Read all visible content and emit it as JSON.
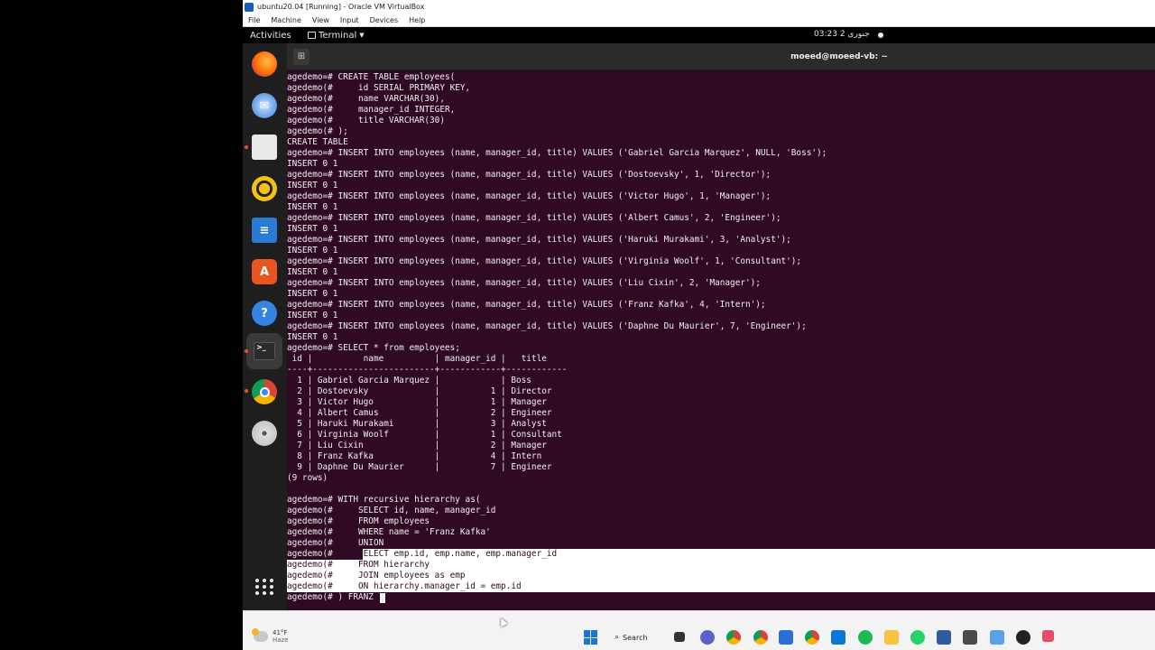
{
  "vbox": {
    "title": "ubuntu20.04 [Running] - Oracle VM VirtualBox",
    "menu": [
      "File",
      "Machine",
      "View",
      "Input",
      "Devices",
      "Help"
    ]
  },
  "topbar": {
    "activities": "Activities",
    "app_menu": "Terminal",
    "clock": "03:23  جنوری 2"
  },
  "terminal": {
    "title": "moeed@moeed-vb: ~",
    "lines": [
      "agedemo=# CREATE TABLE employees(",
      "agedemo(#     id SERIAL PRIMARY KEY,",
      "agedemo(#     name VARCHAR(30),",
      "agedemo(#     manager_id INTEGER,",
      "agedemo(#     title VARCHAR(30)",
      "agedemo(# );",
      "CREATE TABLE",
      "agedemo=# INSERT INTO employees (name, manager_id, title) VALUES ('Gabriel Garcia Marquez', NULL, 'Boss');",
      "INSERT 0 1",
      "agedemo=# INSERT INTO employees (name, manager_id, title) VALUES ('Dostoevsky', 1, 'Director');",
      "INSERT 0 1",
      "agedemo=# INSERT INTO employees (name, manager_id, title) VALUES ('Victor Hugo', 1, 'Manager');",
      "INSERT 0 1",
      "agedemo=# INSERT INTO employees (name, manager_id, title) VALUES ('Albert Camus', 2, 'Engineer');",
      "INSERT 0 1",
      "agedemo=# INSERT INTO employees (name, manager_id, title) VALUES ('Haruki Murakami', 3, 'Analyst');",
      "INSERT 0 1",
      "agedemo=# INSERT INTO employees (name, manager_id, title) VALUES ('Virginia Woolf', 1, 'Consultant');",
      "INSERT 0 1",
      "agedemo=# INSERT INTO employees (name, manager_id, title) VALUES ('Liu Cixin', 2, 'Manager');",
      "INSERT 0 1",
      "agedemo=# INSERT INTO employees (name, manager_id, title) VALUES ('Franz Kafka', 4, 'Intern');",
      "INSERT 0 1",
      "agedemo=# INSERT INTO employees (name, manager_id, title) VALUES ('Daphne Du Maurier', 7, 'Engineer');",
      "INSERT 0 1",
      "agedemo=# SELECT * from employees;",
      " id |          name          | manager_id |   title",
      "----+------------------------+------------+------------",
      "  1 | Gabriel Garcia Marquez |            | Boss",
      "  2 | Dostoevsky             |          1 | Director",
      "  3 | Victor Hugo            |          1 | Manager",
      "  4 | Albert Camus           |          2 | Engineer",
      "  5 | Haruki Murakami        |          3 | Analyst",
      "  6 | Virginia Woolf         |          1 | Consultant",
      "  7 | Liu Cixin              |          2 | Manager",
      "  8 | Franz Kafka            |          4 | Intern",
      "  9 | Daphne Du Maurier      |          7 | Engineer",
      "(9 rows)",
      "",
      "agedemo=# WITH recursive hierarchy as(",
      "agedemo(#     SELECT id, name, manager_id",
      "agedemo(#     FROM employees",
      "agedemo(#     WHERE name = 'Franz Kafka'",
      "agedemo(#     UNION",
      "agedemo(#     SELECT emp.id, emp.name, emp.manager_id",
      "agedemo(#     FROM hierarchy",
      "agedemo(#     JOIN employees as emp",
      "agedemo(#     ON hierarchy.manager_id = emp.id",
      "agedemo(# ) FRANZ"
    ]
  },
  "taskbar": {
    "weather_temp": "41°F",
    "weather_desc": "Haze",
    "search_label": "Search"
  },
  "colors": {
    "terminal_bg": "#300a24",
    "ubuntu_orange": "#e95420"
  }
}
